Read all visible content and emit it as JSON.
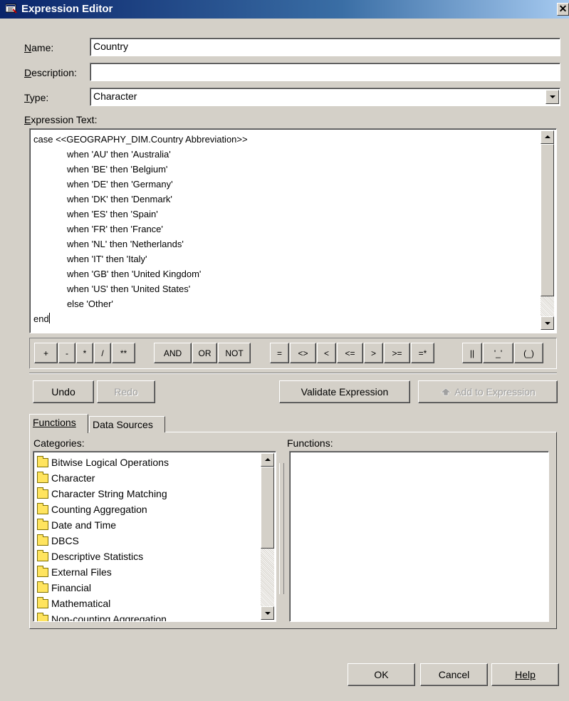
{
  "window": {
    "title": "Expression Editor",
    "close_icon": "close-icon"
  },
  "form": {
    "name_label": "Name:",
    "name_value": "Country",
    "description_label": "Description:",
    "description_value": "",
    "type_label": "Type:",
    "type_value": "Character",
    "expression_label": "Expression Text:"
  },
  "expression_lines": [
    "case <<GEOGRAPHY_DIM.Country Abbreviation>>",
    "             when 'AU' then 'Australia'",
    "             when 'BE' then 'Belgium'",
    "             when 'DE' then 'Germany'",
    "             when 'DK' then 'Denmark'",
    "             when 'ES' then 'Spain'",
    "             when 'FR' then 'France'",
    "             when 'NL' then 'Netherlands'",
    "             when 'IT' then 'Italy'",
    "             when 'GB' then 'United Kingdom'",
    "             when 'US' then 'United States'",
    "             else 'Other'",
    "end"
  ],
  "operators": {
    "arith": [
      "+",
      "-",
      "*",
      "/",
      "**"
    ],
    "logic": [
      "AND",
      "OR",
      "NOT"
    ],
    "compare": [
      "=",
      "<>",
      "<",
      "<=",
      ">",
      ">=",
      "=*"
    ],
    "string": [
      "||",
      "'_'",
      "(_)"
    ]
  },
  "actions": {
    "undo": "Undo",
    "redo": "Redo",
    "validate": "Validate Expression",
    "add": "Add to Expression"
  },
  "tabs": [
    "Functions",
    "Data Sources"
  ],
  "categories_label": "Categories:",
  "functions_label": "Functions:",
  "categories": [
    "Bitwise Logical Operations",
    "Character",
    "Character String Matching",
    "Counting Aggregation",
    "Date and Time",
    "DBCS",
    "Descriptive Statistics",
    "External Files",
    "Financial",
    "Mathematical",
    "Non-counting Aggregation"
  ],
  "functions": [],
  "footer": {
    "ok": "OK",
    "cancel": "Cancel",
    "help": "Help"
  }
}
